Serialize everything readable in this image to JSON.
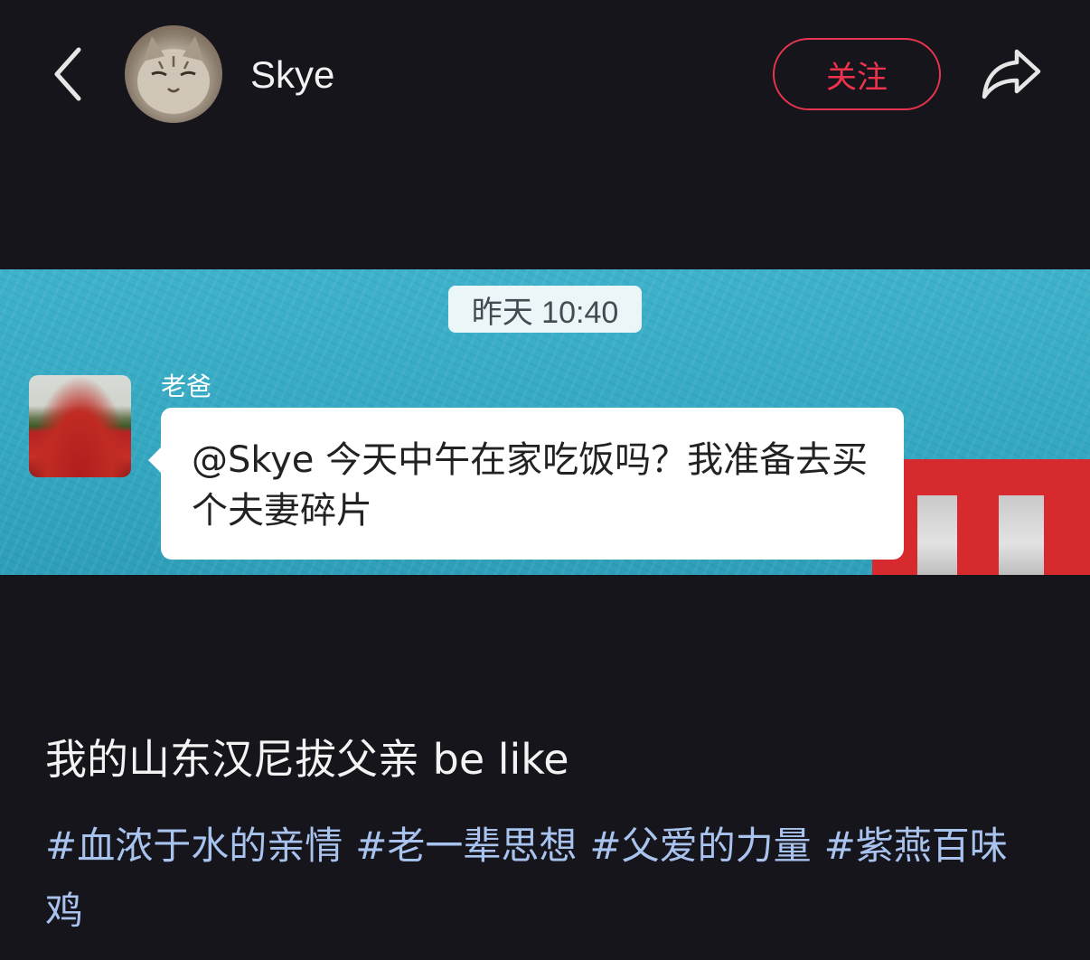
{
  "header": {
    "back_icon": "chevron-left-icon",
    "username": "Skye",
    "follow_label": "关注",
    "share_icon": "share-arrow-icon"
  },
  "chat": {
    "timestamp": "昨天 10:40",
    "sender_name": "老爸",
    "message": "@Skye 今天中午在家吃饭吗？我准备去买个夫妻碎片"
  },
  "post": {
    "caption": "我的山东汉尼拔父亲 be like",
    "tags": [
      "#血浓于水的亲情",
      "#老一辈思想",
      "#父爱的力量",
      "#紫燕百味鸡"
    ]
  },
  "colors": {
    "background": "#16151c",
    "accent_red": "#e8344e",
    "tag_blue": "#a9c3ef",
    "chat_bg": "#3fb2cb"
  }
}
